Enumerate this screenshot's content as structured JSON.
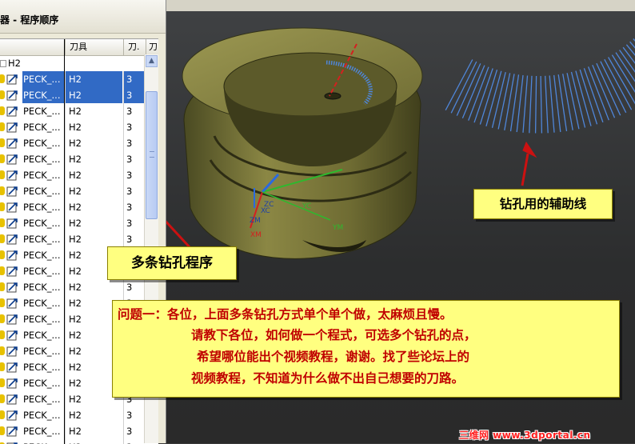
{
  "navigator": {
    "title": "器 - 程序顺序",
    "columns": {
      "tool": "刀具",
      "num": "刀.",
      "extra": "刀"
    },
    "group_label": "H2",
    "rows": [
      {
        "name": "PECK_...",
        "tool": "H2",
        "num": "3",
        "selected": true
      },
      {
        "name": "PECK_...",
        "tool": "H2",
        "num": "3",
        "selected": true
      },
      {
        "name": "PECK_...",
        "tool": "H2",
        "num": "3",
        "selected": false
      },
      {
        "name": "PECK_...",
        "tool": "H2",
        "num": "3",
        "selected": false
      },
      {
        "name": "PECK_...",
        "tool": "H2",
        "num": "3",
        "selected": false
      },
      {
        "name": "PECK_...",
        "tool": "H2",
        "num": "3",
        "selected": false
      },
      {
        "name": "PECK_...",
        "tool": "H2",
        "num": "3",
        "selected": false
      },
      {
        "name": "PECK_...",
        "tool": "H2",
        "num": "3",
        "selected": false
      },
      {
        "name": "PECK_...",
        "tool": "H2",
        "num": "3",
        "selected": false
      },
      {
        "name": "PECK_...",
        "tool": "H2",
        "num": "3",
        "selected": false
      },
      {
        "name": "PECK_...",
        "tool": "H2",
        "num": "3",
        "selected": false
      },
      {
        "name": "PECK_...",
        "tool": "H2",
        "num": "3",
        "selected": false
      },
      {
        "name": "PECK_...",
        "tool": "H2",
        "num": "3",
        "selected": false
      },
      {
        "name": "PECK_...",
        "tool": "H2",
        "num": "3",
        "selected": false
      },
      {
        "name": "PECK_...",
        "tool": "H2",
        "num": "3",
        "selected": false
      },
      {
        "name": "PECK_...",
        "tool": "H2",
        "num": "3",
        "selected": false
      },
      {
        "name": "PECK_...",
        "tool": "H2",
        "num": "3",
        "selected": false
      },
      {
        "name": "PECK_...",
        "tool": "H2",
        "num": "3",
        "selected": false
      },
      {
        "name": "PECK_...",
        "tool": "H2",
        "num": "3",
        "selected": false
      },
      {
        "name": "PECK_...",
        "tool": "H2",
        "num": "3",
        "selected": false
      },
      {
        "name": "PECK_...",
        "tool": "H2",
        "num": "3",
        "selected": false
      },
      {
        "name": "PECK_...",
        "tool": "H2",
        "num": "3",
        "selected": false
      },
      {
        "name": "PECK_...",
        "tool": "H2",
        "num": "3",
        "selected": false
      },
      {
        "name": "PECK_...",
        "tool": "H2",
        "num": "3",
        "selected": false
      }
    ]
  },
  "axes": {
    "xc": "XC",
    "yc": "YC",
    "zc": "ZC",
    "xm": "XM",
    "ym": "YM",
    "zm": "ZM"
  },
  "callouts": {
    "aux_lines": "钻孔用的辅助线",
    "programs": "多条钻孔程序",
    "question_lines": [
      "问题一：各位，上面多条钻孔方式单个单个做，太麻烦且慢。",
      "请教下各位，如何做一个程式，可选多个钻孔的点，",
      "希望哪位能出个视频教程，谢谢。找了些论坛上的",
      "视频教程，不知道为什么做不出自己想要的刀路。"
    ]
  },
  "watermark": "三维网 www.3dportal.cn",
  "colors": {
    "selection": "#316ac5",
    "callout_bg": "#ffff80",
    "question_text": "#c00000",
    "arrow": "#cc1111",
    "part": "#7d7a3a",
    "aux_line": "#4f86d9"
  }
}
